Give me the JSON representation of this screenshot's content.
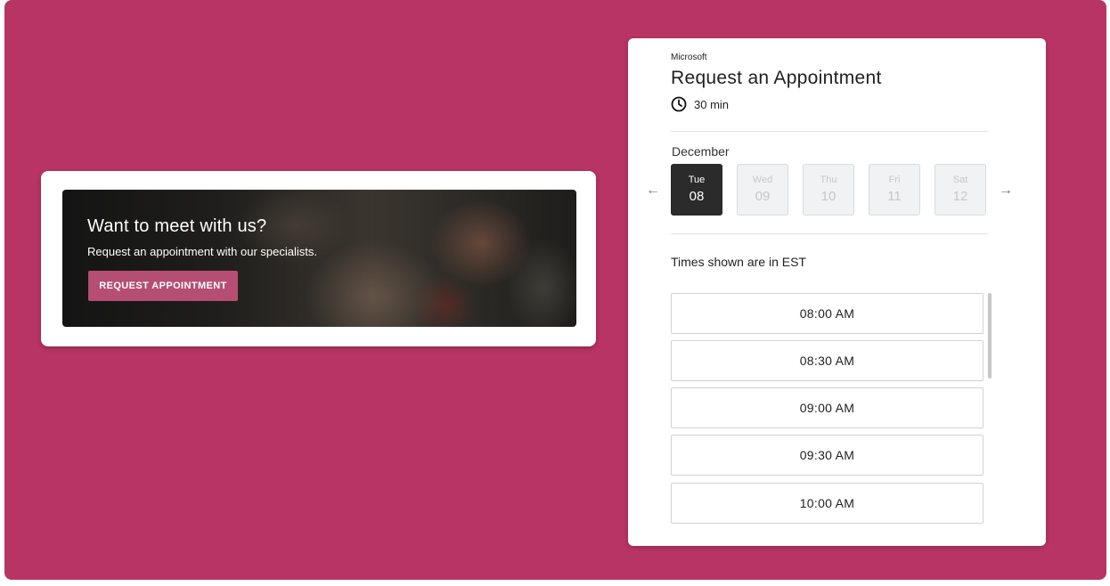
{
  "promo": {
    "title": "Want to meet with us?",
    "subtitle": "Request an appointment with our specialists.",
    "button_label": "REQUEST APPOINTMENT"
  },
  "booking": {
    "organization": "Microsoft",
    "title": "Request an Appointment",
    "duration": "30 min",
    "duration_icon": "clock-icon",
    "month": "December",
    "prev_icon": "arrow-left-icon",
    "next_icon": "arrow-right-icon",
    "prev_glyph": "←",
    "next_glyph": "→",
    "days": [
      {
        "name": "Tue",
        "num": "08",
        "state": "selected"
      },
      {
        "name": "Wed",
        "num": "09",
        "state": "disabled"
      },
      {
        "name": "Thu",
        "num": "10",
        "state": "disabled"
      },
      {
        "name": "Fri",
        "num": "11",
        "state": "disabled"
      },
      {
        "name": "Sat",
        "num": "12",
        "state": "disabled"
      }
    ],
    "timezone_note": "Times shown are in EST",
    "slots": [
      "08:00 AM",
      "08:30 AM",
      "09:00 AM",
      "09:30 AM",
      "10:00 AM"
    ]
  },
  "colors": {
    "background": "#b83465",
    "button": "#b54e72",
    "selected_day": "#2b2b2b"
  }
}
